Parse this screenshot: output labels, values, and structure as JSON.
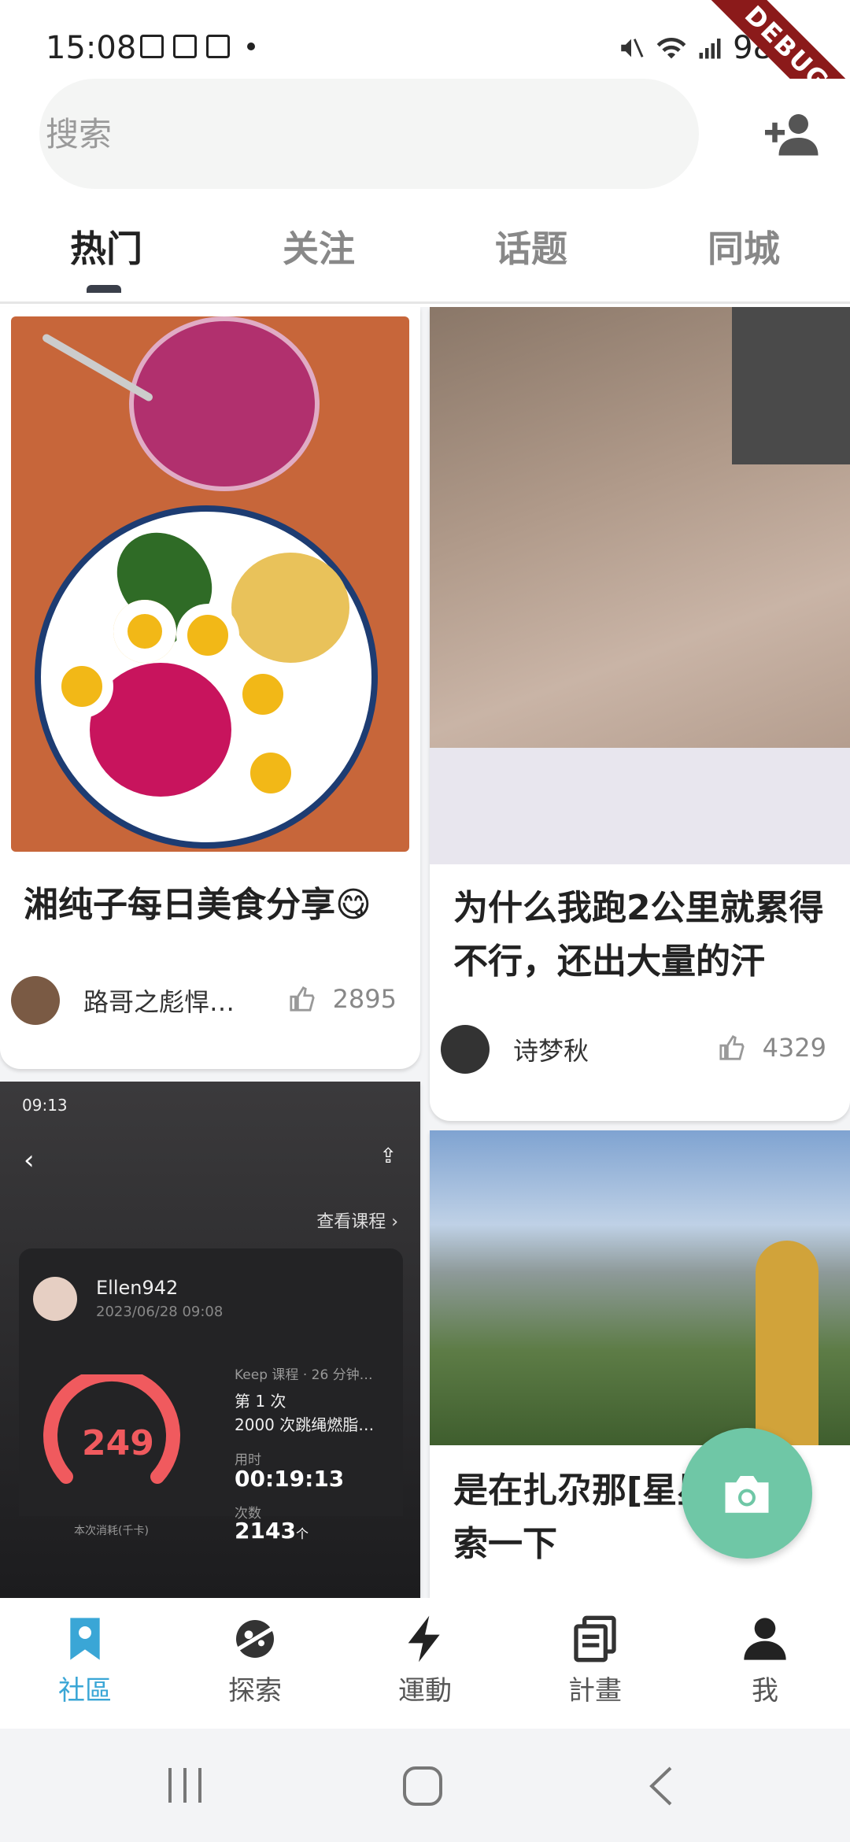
{
  "status_bar": {
    "time": "15:08",
    "battery": "98%",
    "debug": "DEBUG"
  },
  "search": {
    "placeholder": "搜索"
  },
  "tabs": [
    {
      "label": "热门",
      "active": true
    },
    {
      "label": "关注",
      "active": false
    },
    {
      "label": "话题",
      "active": false
    },
    {
      "label": "同城",
      "active": false
    }
  ],
  "posts": [
    {
      "title": "湘纯子每日美食分享😋",
      "author": "路哥之彪悍…",
      "likes": "2895"
    },
    {
      "title": "为什么我跑2公里就累得不行，还出大量的汗",
      "author": "诗梦秋",
      "likes": "4329"
    },
    {
      "title": "是在扎尕那[星星]，搜索一下"
    }
  ],
  "workout_screenshot": {
    "time": "09:13",
    "view_course": "查看课程",
    "user": "Ellen942",
    "datetime": "2023/06/28 09:08",
    "calories": "249",
    "calories_label": "本次消耗(千卡)",
    "course_meta": "Keep 课程 · 26 分钟…",
    "session": "第 1 次",
    "course_name": "2000 次跳绳燃脂…",
    "duration_label": "用时",
    "duration": "00:19:13",
    "count_label": "次数",
    "count": "2143",
    "count_unit": "个"
  },
  "bottom_nav": [
    {
      "label": "社區",
      "icon": "bookmark-pin-icon",
      "active": true
    },
    {
      "label": "探索",
      "icon": "planet-icon",
      "active": false
    },
    {
      "label": "運動",
      "icon": "lightning-icon",
      "active": false
    },
    {
      "label": "計畫",
      "icon": "documents-icon",
      "active": false
    },
    {
      "label": "我",
      "icon": "person-icon",
      "active": false
    }
  ],
  "colors": {
    "accent": "#3aa6d6",
    "fab": "#6fc7a6",
    "debug_ribbon": "#8b1a1a"
  }
}
